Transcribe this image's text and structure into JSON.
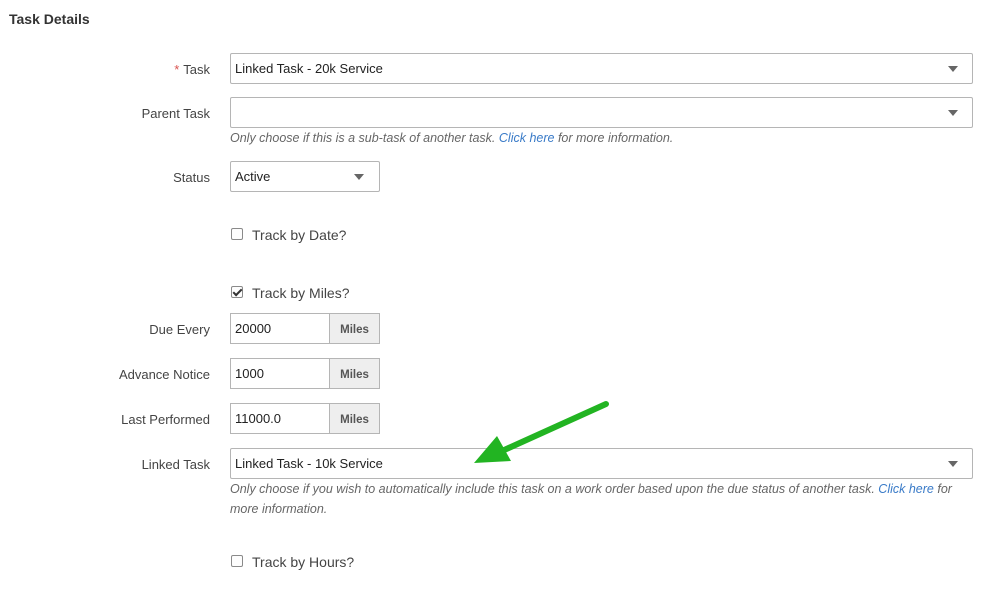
{
  "section": {
    "title": "Task Details"
  },
  "task": {
    "required_marker": "*",
    "label": "Task",
    "value": "Linked Task - 20k Service"
  },
  "parent_task": {
    "label": "Parent Task",
    "value": "",
    "help_before": "Only choose if this is a sub-task of another task.",
    "help_link": "Click here",
    "help_after": "for more information."
  },
  "status": {
    "label": "Status",
    "value": "Active"
  },
  "track_by_date": {
    "label": "Track by Date?",
    "checked": false
  },
  "track_by_miles": {
    "label": "Track by Miles?",
    "checked": true
  },
  "due_every": {
    "label": "Due Every",
    "value": "20000",
    "unit": "Miles"
  },
  "advance_notice": {
    "label": "Advance Notice",
    "value": "1000",
    "unit": "Miles"
  },
  "last_performed": {
    "label": "Last Performed",
    "value": "11000.0",
    "unit": "Miles"
  },
  "linked_task": {
    "label": "Linked Task",
    "value": "Linked Task - 10k Service",
    "help_before": "Only choose if you wish to automatically include this task on a work order based upon the due status of another task.",
    "help_link": "Click here",
    "help_after": "for more information."
  },
  "track_by_hours": {
    "label": "Track by Hours?",
    "checked": false
  },
  "annotation": {
    "arrow_color": "#22b422"
  }
}
